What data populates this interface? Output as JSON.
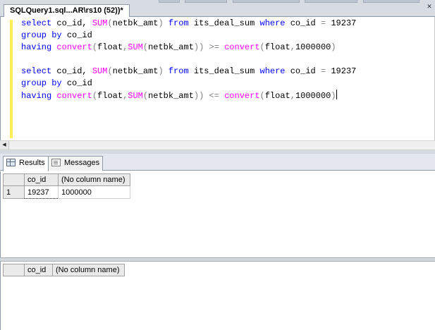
{
  "document_tab": {
    "title": "SQLQuery1.sql...AR\\rs10 (52))*"
  },
  "editor": {
    "lines": [
      [
        {
          "t": "select",
          "c": "kw"
        },
        {
          "t": " co_id, ",
          "c": ""
        },
        {
          "t": "SUM",
          "c": "fn"
        },
        {
          "t": "(",
          "c": "op"
        },
        {
          "t": "netbk_amt",
          "c": ""
        },
        {
          "t": ")",
          "c": "op"
        },
        {
          "t": " ",
          "c": ""
        },
        {
          "t": "from",
          "c": "kw"
        },
        {
          "t": " its_deal_sum ",
          "c": ""
        },
        {
          "t": "where",
          "c": "kw"
        },
        {
          "t": " co_id ",
          "c": ""
        },
        {
          "t": "=",
          "c": "op"
        },
        {
          "t": " 19237",
          "c": ""
        }
      ],
      [
        {
          "t": "group",
          "c": "kw"
        },
        {
          "t": " ",
          "c": ""
        },
        {
          "t": "by",
          "c": "kw"
        },
        {
          "t": " co_id",
          "c": ""
        }
      ],
      [
        {
          "t": "having",
          "c": "kw"
        },
        {
          "t": " ",
          "c": ""
        },
        {
          "t": "convert",
          "c": "fn"
        },
        {
          "t": "(",
          "c": "op"
        },
        {
          "t": "float",
          "c": ""
        },
        {
          "t": ",",
          "c": "op"
        },
        {
          "t": "SUM",
          "c": "fn"
        },
        {
          "t": "(",
          "c": "op"
        },
        {
          "t": "netbk_amt",
          "c": ""
        },
        {
          "t": "))",
          "c": "op"
        },
        {
          "t": " ",
          "c": ""
        },
        {
          "t": ">=",
          "c": "op"
        },
        {
          "t": " ",
          "c": ""
        },
        {
          "t": "convert",
          "c": "fn"
        },
        {
          "t": "(",
          "c": "op"
        },
        {
          "t": "float",
          "c": ""
        },
        {
          "t": ",",
          "c": "op"
        },
        {
          "t": "1000000",
          "c": ""
        },
        {
          "t": ")",
          "c": "op"
        }
      ],
      [],
      [
        {
          "t": "select",
          "c": "kw"
        },
        {
          "t": " co_id, ",
          "c": ""
        },
        {
          "t": "SUM",
          "c": "fn"
        },
        {
          "t": "(",
          "c": "op"
        },
        {
          "t": "netbk_amt",
          "c": ""
        },
        {
          "t": ")",
          "c": "op"
        },
        {
          "t": " ",
          "c": ""
        },
        {
          "t": "from",
          "c": "kw"
        },
        {
          "t": " its_deal_sum ",
          "c": ""
        },
        {
          "t": "where",
          "c": "kw"
        },
        {
          "t": " co_id ",
          "c": ""
        },
        {
          "t": "=",
          "c": "op"
        },
        {
          "t": " 19237",
          "c": ""
        }
      ],
      [
        {
          "t": "group",
          "c": "kw"
        },
        {
          "t": " ",
          "c": ""
        },
        {
          "t": "by",
          "c": "kw"
        },
        {
          "t": " co_id",
          "c": ""
        }
      ],
      [
        {
          "t": "having",
          "c": "kw"
        },
        {
          "t": " ",
          "c": ""
        },
        {
          "t": "convert",
          "c": "fn"
        },
        {
          "t": "(",
          "c": "op"
        },
        {
          "t": "float",
          "c": ""
        },
        {
          "t": ",",
          "c": "op"
        },
        {
          "t": "SUM",
          "c": "fn"
        },
        {
          "t": "(",
          "c": "op"
        },
        {
          "t": "netbk_amt",
          "c": ""
        },
        {
          "t": "))",
          "c": "op"
        },
        {
          "t": " ",
          "c": ""
        },
        {
          "t": "<=",
          "c": "op"
        },
        {
          "t": " ",
          "c": ""
        },
        {
          "t": "convert",
          "c": "fn"
        },
        {
          "t": "(",
          "c": "op"
        },
        {
          "t": "float",
          "c": ""
        },
        {
          "t": ",",
          "c": "op"
        },
        {
          "t": "1000000",
          "c": ""
        },
        {
          "t": ")",
          "c": "op"
        }
      ]
    ],
    "caret_line": 6,
    "colors": {
      "keyword": "#0000ff",
      "function": "#ff00ff",
      "operator": "#808080",
      "change_bar": "#ffee58"
    }
  },
  "result_tabs": {
    "results_label": "Results",
    "messages_label": "Messages"
  },
  "results": {
    "grid1": {
      "columns": [
        "co_id",
        "(No column name)"
      ],
      "rows": [
        {
          "row_number": "1",
          "cells": [
            "19237",
            "1000000"
          ]
        }
      ]
    },
    "grid2": {
      "columns": [
        "co_id",
        "(No column name)"
      ],
      "rows": []
    }
  }
}
